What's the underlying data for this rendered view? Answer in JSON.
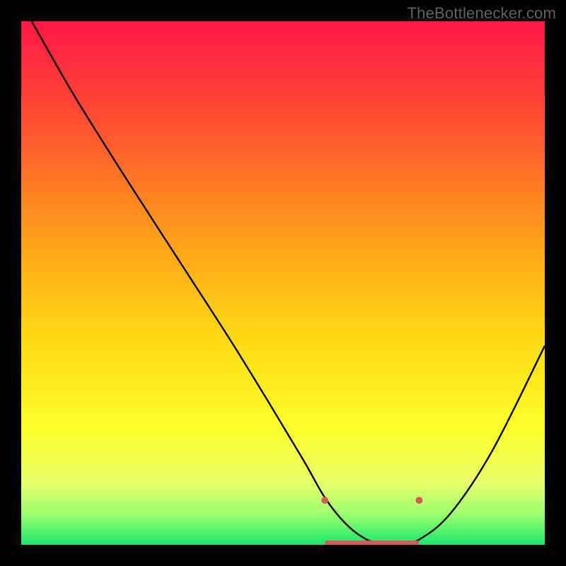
{
  "watermark": "TheBottlenecker.com",
  "chart_data": {
    "type": "line",
    "title": "",
    "xlabel": "",
    "ylabel": "",
    "xlim": [
      0,
      100
    ],
    "ylim": [
      0,
      100
    ],
    "gradient_stops": [
      {
        "offset": 0,
        "color": "#ff1846"
      },
      {
        "offset": 20,
        "color": "#ff5130"
      },
      {
        "offset": 40,
        "color": "#ff9a1a"
      },
      {
        "offset": 60,
        "color": "#ffd814"
      },
      {
        "offset": 78,
        "color": "#fdff2a"
      },
      {
        "offset": 88,
        "color": "#e8ff6a"
      },
      {
        "offset": 94,
        "color": "#9eff6e"
      },
      {
        "offset": 100,
        "color": "#19e86c"
      }
    ],
    "series": [
      {
        "name": "bottleneck-curve",
        "color": "#000000",
        "x": [
          2,
          10,
          20,
          30,
          40,
          48,
          54,
          58,
          62,
          66,
          70,
          72,
          76,
          82,
          90,
          100
        ],
        "y": [
          100,
          86,
          70,
          54.5,
          39,
          26,
          16,
          9,
          4,
          1,
          0,
          0,
          1,
          6,
          18,
          38
        ]
      }
    ],
    "markers": [
      {
        "name": "marker-left",
        "x": 58,
        "y": 8.5,
        "r": 5,
        "color": "#d65a5a"
      },
      {
        "name": "marker-right",
        "x": 76,
        "y": 8.5,
        "r": 5,
        "color": "#d65a5a"
      }
    ],
    "flat_band": {
      "x0": 58,
      "x1": 76,
      "y": 0,
      "thickness": 6,
      "color": "#d65a5a"
    }
  }
}
